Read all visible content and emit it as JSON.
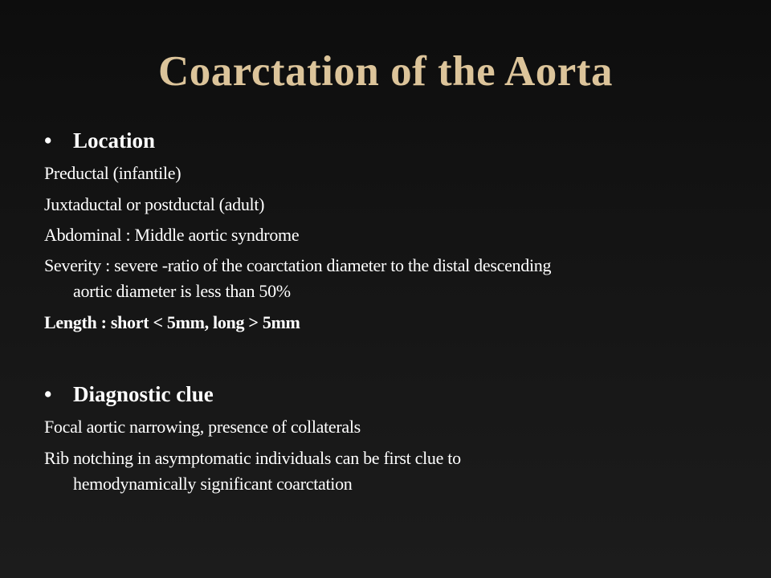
{
  "title": "Coarctation of the Aorta",
  "sections": [
    {
      "heading": "Location",
      "lines": [
        {
          "text": "Preductal (infantile)"
        },
        {
          "text": "Juxtaductal or postductal (adult)"
        },
        {
          "text": "Abdominal : Middle aortic syndrome"
        },
        {
          "text": "Severity : severe -ratio of the coarctation diameter to the distal descending",
          "cont": "aortic diameter is less than 50%"
        },
        {
          "text": "Length : short < 5mm, long > 5mm"
        }
      ]
    },
    {
      "heading": "Diagnostic clue",
      "lines": [
        {
          "text": "Focal aortic narrowing, presence of collaterals"
        },
        {
          "text": "Rib notching in asymptomatic individuals can be first clue to",
          "cont": "hemodynamically significant coarctation"
        }
      ]
    }
  ],
  "bullet_glyph": "•"
}
